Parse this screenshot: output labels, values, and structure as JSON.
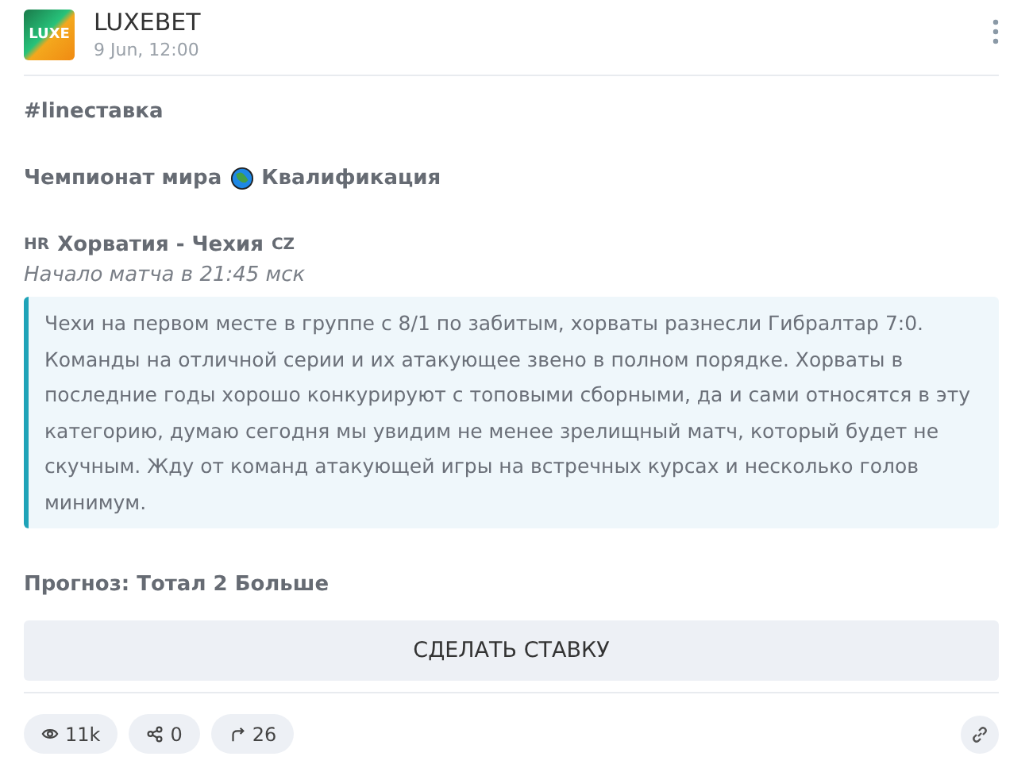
{
  "post": {
    "author": "LUXEBET",
    "avatar_text": "LUXE",
    "date": "9 Jun, 12:00"
  },
  "hashtag": "#lineставка",
  "tournament": {
    "before": "Чемпионат мира",
    "after": "Квалификация"
  },
  "match": {
    "home_code": "HR",
    "title": "Хорватия - Чехия",
    "away_code": "CZ",
    "time": "Начало матча в 21:45 мск"
  },
  "quote": "Чехи на первом месте в группе с 8/1 по забитым, хорваты разнесли Гибралтар 7:0. Команды на отличной серии и их атакующее звено в полном порядке. Хорваты в последние годы хорошо конкурируют с топовыми сборными, да и сами относятся в эту категорию, думаю сегодня мы увидим не менее зрелищный матч, который будет не скучным. Жду от команд атакующей игры на встречных курсах и несколько голов минимум.",
  "forecast": "Прогноз: Тотал 2 Больше",
  "action_button": "СДЕЛАТЬ СТАВКУ",
  "stats": [
    {
      "kind": "views",
      "count": "11k"
    },
    {
      "kind": "shares",
      "count": "0"
    },
    {
      "kind": "forwards",
      "count": "26"
    }
  ]
}
